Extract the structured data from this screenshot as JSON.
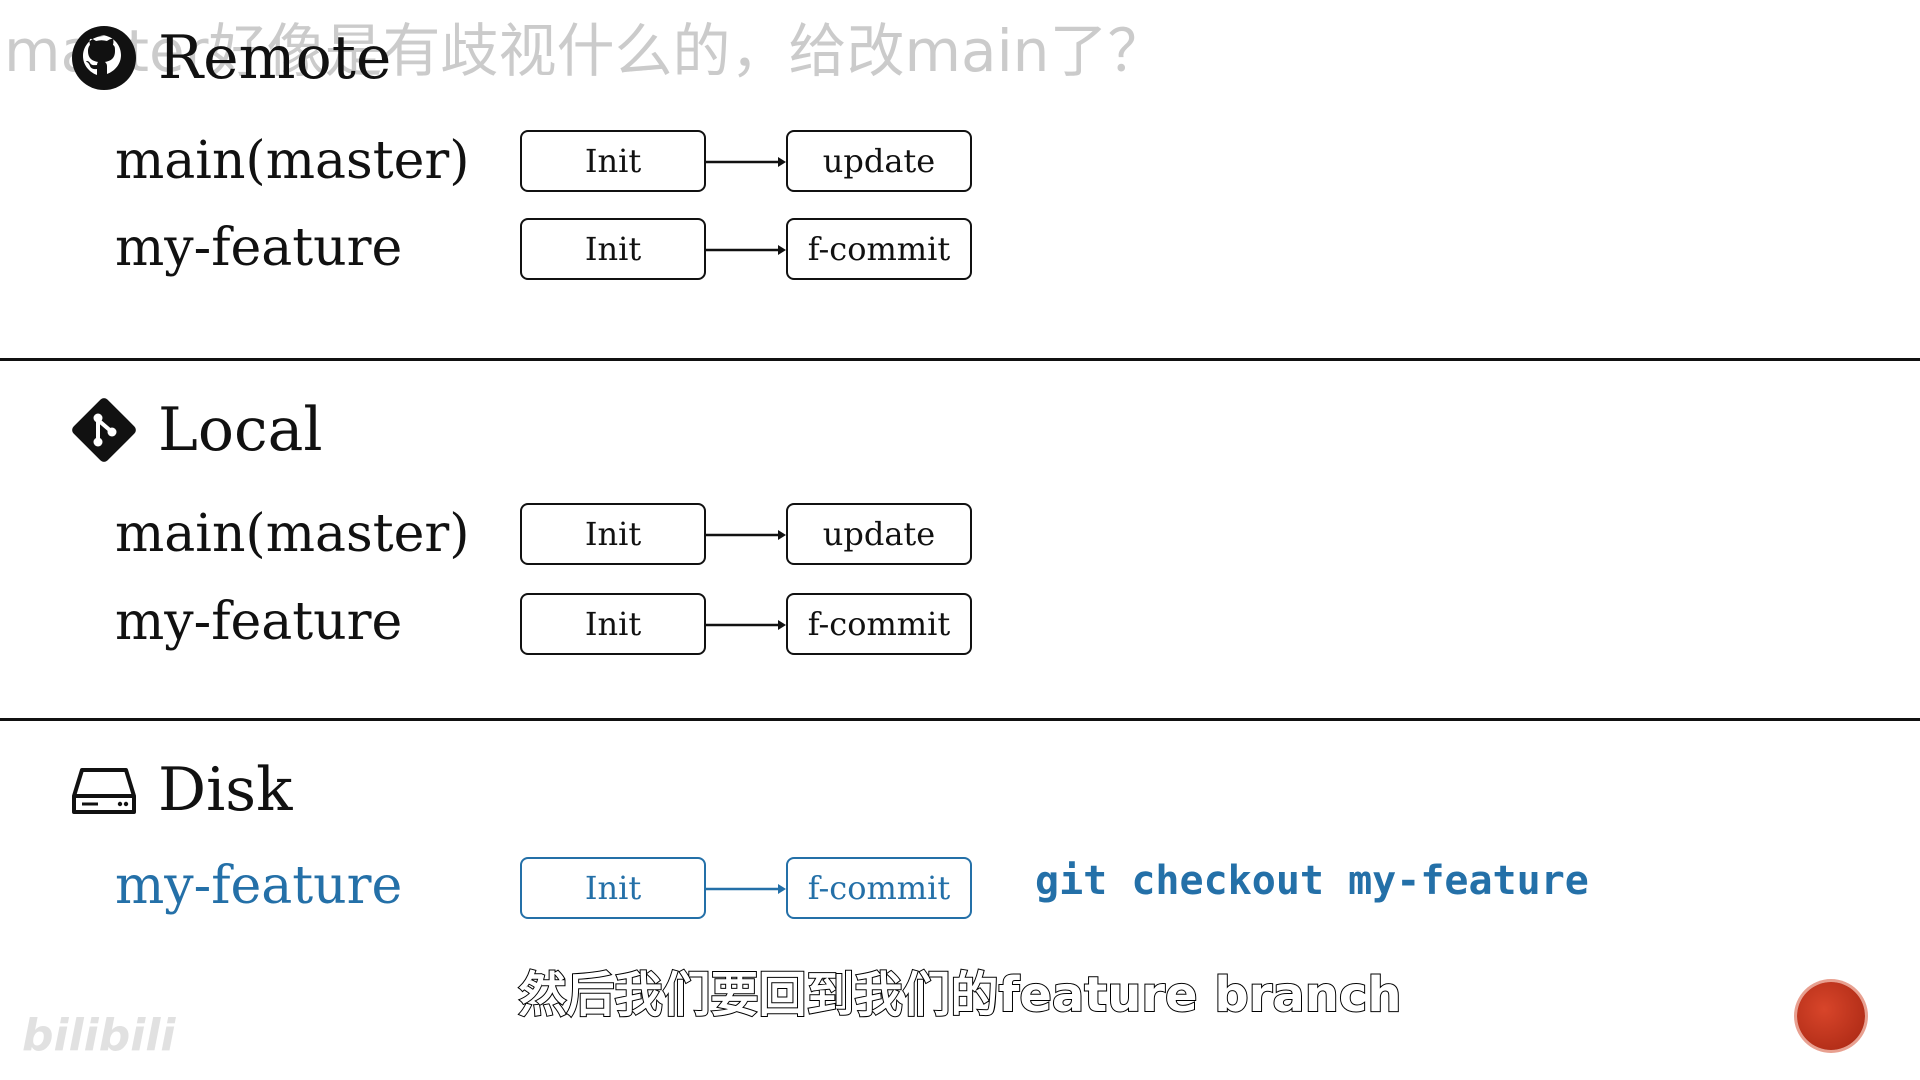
{
  "overlay_text": "master好像是有歧视什么的，给改main了？",
  "sections": [
    {
      "title": "Remote",
      "icon": "github-icon",
      "branches": [
        {
          "label": "main(master)",
          "commits": [
            "Init",
            "update"
          ]
        },
        {
          "label": "my-feature",
          "commits": [
            "Init",
            "f-commit"
          ]
        }
      ]
    },
    {
      "title": "Local",
      "icon": "git-icon",
      "branches": [
        {
          "label": "main(master)",
          "commits": [
            "Init",
            "update"
          ]
        },
        {
          "label": "my-feature",
          "commits": [
            "Init",
            "f-commit"
          ]
        }
      ]
    },
    {
      "title": "Disk",
      "icon": "disk-icon",
      "branches": [
        {
          "label": "my-feature",
          "commits": [
            "Init",
            "f-commit"
          ]
        }
      ],
      "command": "git checkout my-feature"
    }
  ],
  "subtitle": "然后我们要回到我们的feature branch",
  "watermark": "bilibili",
  "colors": {
    "highlight": "#2470a8",
    "ink": "#111111",
    "record_dot": "#c0361c"
  }
}
